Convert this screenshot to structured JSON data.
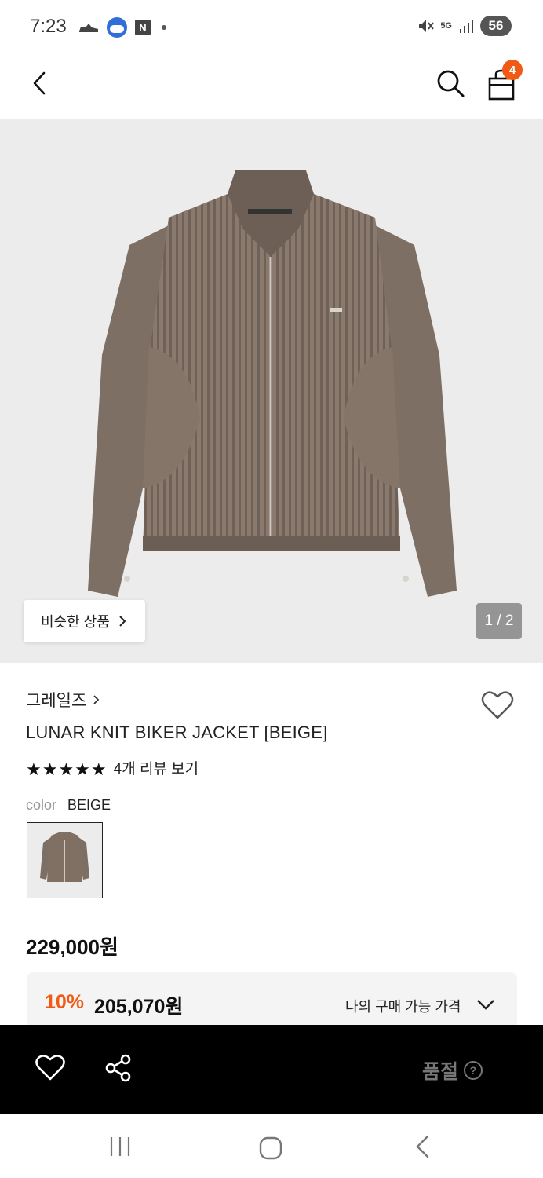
{
  "status_bar": {
    "time": "7:23",
    "network": "5G",
    "battery": "56",
    "icons": [
      "shoe-app-icon",
      "toon-app-icon",
      "naver-icon",
      "notification-dot",
      "mute-icon",
      "signal-icon"
    ]
  },
  "header": {
    "icons": [
      "back-arrow-icon",
      "search-icon",
      "shopping-bag-icon"
    ],
    "cart_count": "4"
  },
  "gallery": {
    "similar_label": "비슷한 상품",
    "page_indicator": "1 / 2"
  },
  "product": {
    "brand": "그레일즈",
    "name": "LUNAR KNIT BIKER JACKET [BEIGE]",
    "rating_stars": 5,
    "review_link": "4개 리뷰 보기",
    "color_label": "color",
    "color_value": "BEIGE",
    "price": "229,000원",
    "discount_rate": "10%",
    "discount_price": "205,070원",
    "my_price_label": "나의 구매 가능 가격"
  },
  "action_bar": {
    "soldout_label": "품절",
    "icons": [
      "heart-icon",
      "share-icon",
      "help-icon"
    ]
  },
  "nav_bar": {
    "icons": [
      "recent-apps-icon",
      "home-icon",
      "back-icon"
    ]
  },
  "colors": {
    "accent": "#f05a14",
    "image_background": "#ececec",
    "action_bar": "#000000"
  }
}
